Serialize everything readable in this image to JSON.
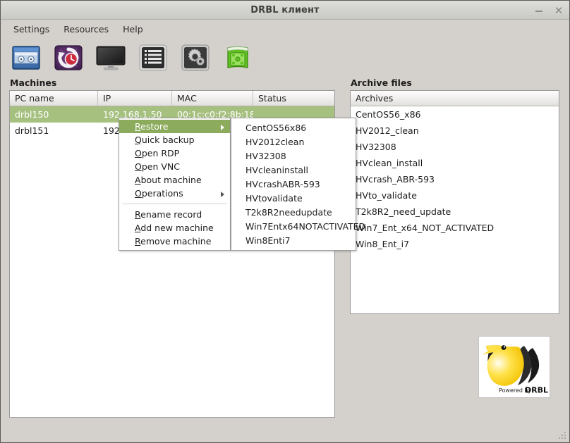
{
  "window": {
    "title": "DRBL клиент",
    "minimize_label": "–",
    "close_label": "✕"
  },
  "menubar": {
    "items": [
      {
        "label": "Settings"
      },
      {
        "label": "Resources"
      },
      {
        "label": "Help"
      }
    ]
  },
  "toolbar": {
    "buttons": [
      {
        "icon": "backup-tape-icon",
        "tooltip": "Backup"
      },
      {
        "icon": "restore-clock-icon",
        "tooltip": "Restore"
      },
      {
        "icon": "monitor-icon",
        "tooltip": "Monitor"
      },
      {
        "icon": "list-icon",
        "tooltip": "List"
      },
      {
        "icon": "gears-settings-icon",
        "tooltip": "Settings"
      },
      {
        "icon": "green-book-icon",
        "tooltip": "Documentation"
      }
    ]
  },
  "machines": {
    "title": "Machines",
    "columns": [
      "PC name",
      "IP",
      "MAC",
      "Status"
    ],
    "rows": [
      {
        "pc_name": "drbl150",
        "ip": "192.168.1.50",
        "mac": "00:1c:c0:f2:8b:18",
        "status": "",
        "selected": true
      },
      {
        "pc_name": "drbl151",
        "ip": "192",
        "mac": "",
        "status": "",
        "selected": false
      }
    ]
  },
  "archive": {
    "title": "Archive files",
    "column": "Archives",
    "rows": [
      {
        "name": "CentOS56_x86"
      },
      {
        "name": "HV2012_clean"
      },
      {
        "name": "HV32308"
      },
      {
        "name": "HVclean_install"
      },
      {
        "name": "HVcrash_ABR-593"
      },
      {
        "name": "HVto_validate"
      },
      {
        "name": "T2k8R2_need_update"
      },
      {
        "name": "Win7_Ent_x64_NOT_ACTIVATED"
      },
      {
        "name": "Win8_Ent_i7"
      }
    ]
  },
  "context_menu": {
    "items": [
      {
        "label": "Restore",
        "mnemonic": "R",
        "rest": "estore",
        "submenu": true,
        "highlighted": true
      },
      {
        "label": "Quick backup",
        "mnemonic": "Q",
        "rest": "uick backup",
        "submenu": false,
        "highlighted": false
      },
      {
        "label": "Open RDP",
        "mnemonic": "O",
        "rest": "pen RDP",
        "submenu": false,
        "highlighted": false
      },
      {
        "label": "Open VNC",
        "mnemonic": "O",
        "rest": "pen VNC",
        "submenu": false,
        "highlighted": false
      },
      {
        "label": "About machine",
        "mnemonic": "A",
        "rest": "bout machine",
        "submenu": false,
        "highlighted": false
      },
      {
        "label": "Operations",
        "mnemonic": "O",
        "rest": "perations",
        "submenu": true,
        "highlighted": false
      },
      {
        "separator": true
      },
      {
        "label": "Rename record",
        "mnemonic": "R",
        "rest": "ename record",
        "submenu": false,
        "highlighted": false
      },
      {
        "label": "Add new machine",
        "mnemonic": "A",
        "rest": "dd new machine",
        "submenu": false,
        "highlighted": false
      },
      {
        "label": "Remove machine",
        "mnemonic": "R",
        "rest": "emove machine",
        "submenu": false,
        "highlighted": false
      }
    ]
  },
  "submenu": {
    "items": [
      {
        "label": "CentOS56x86"
      },
      {
        "label": "HV2012clean"
      },
      {
        "label": "HV32308"
      },
      {
        "label": "HVcleaninstall"
      },
      {
        "label": "HVcrashABR-593"
      },
      {
        "label": "HVtovalidate"
      },
      {
        "label": "T2k8R2needupdate"
      },
      {
        "label": "Win7Entx64NOTACTIVATED"
      },
      {
        "label": "Win8Enti7"
      }
    ]
  },
  "logo": {
    "caption_prefix": "Powered by ",
    "caption_brand": "DRBL"
  },
  "colors": {
    "selection_green": "#a6c080",
    "menu_highlight_green": "#8cab5d",
    "window_bg": "#d4d0cb",
    "panel_bg": "#ffffff"
  }
}
